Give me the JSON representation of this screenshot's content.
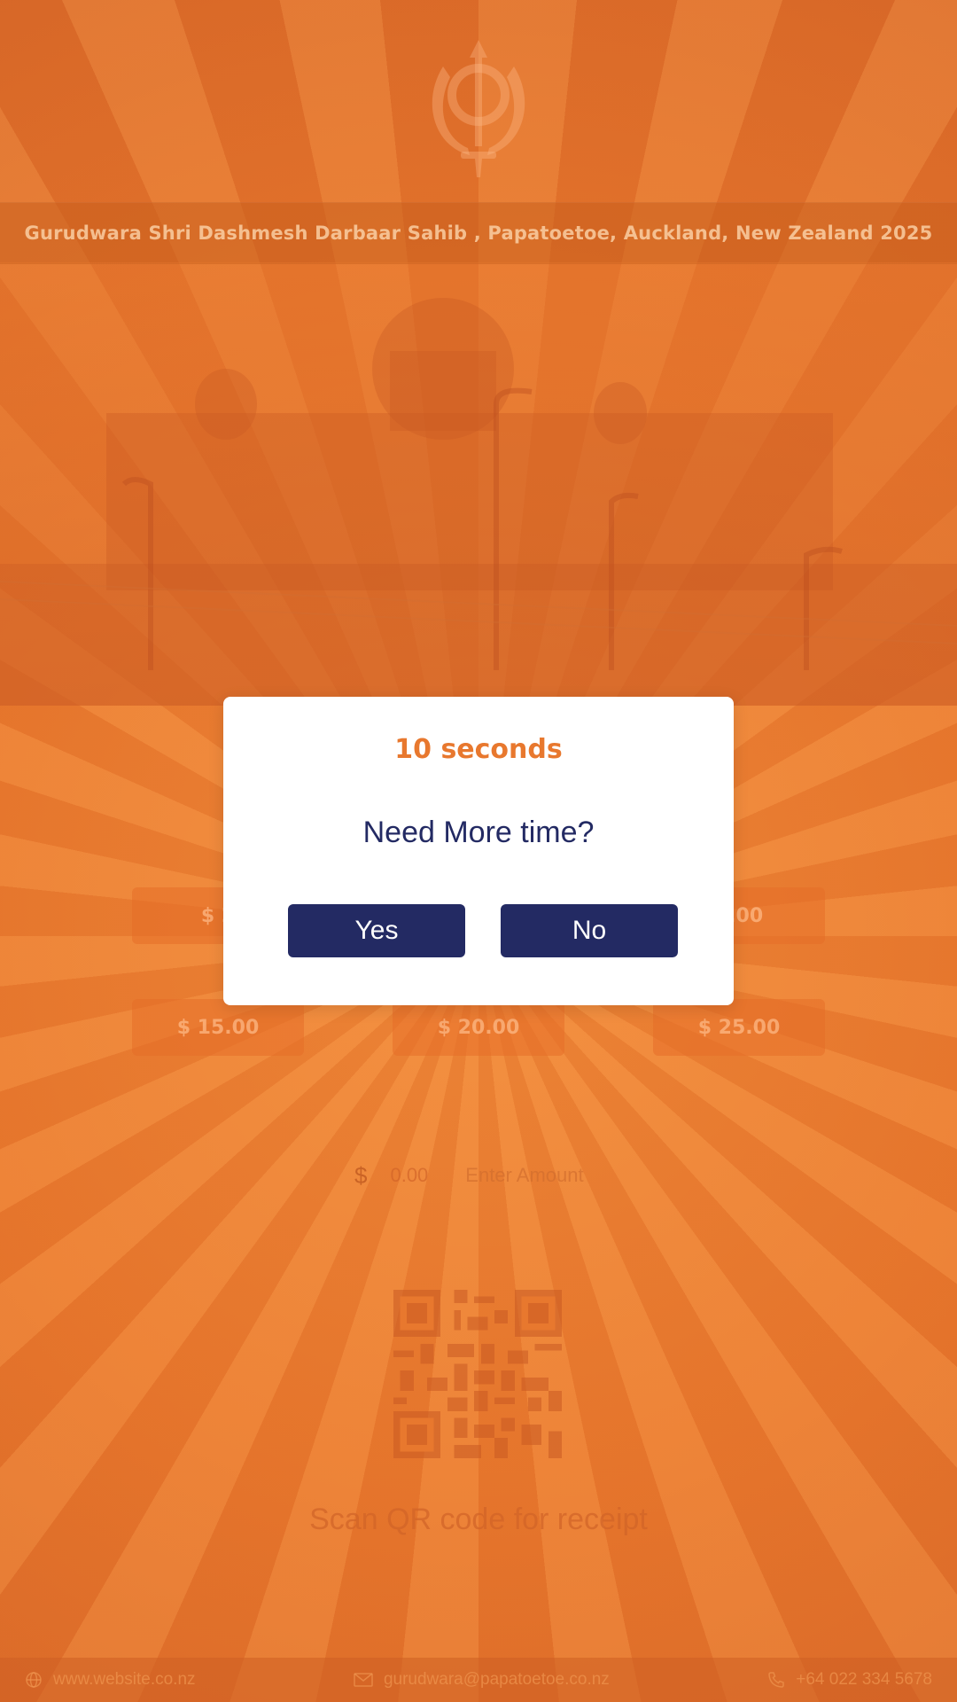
{
  "header": {
    "title": "Gurudwara Shri Dashmesh Darbaar Sahib , Papatoetoe, Auckland, New Zealand 2025",
    "emblem_icon": "khanda-icon"
  },
  "amounts": {
    "row1": [
      "$ 2",
      "",
      "0.00"
    ],
    "row2": [
      "$ 15.00",
      "$ 20.00",
      "$ 25.00"
    ]
  },
  "custom_amount": {
    "currency": "$",
    "value": "0.00",
    "placeholder": "Enter Amount"
  },
  "qr": {
    "caption": "Scan QR code for receipt"
  },
  "footer": {
    "website": "www.website.co.nz",
    "email": "gurudwara@papatoetoe.co.nz",
    "phone": "+64 022 334 5678"
  },
  "modal": {
    "timer": "10 seconds",
    "question": "Need More time?",
    "yes_label": "Yes",
    "no_label": "No"
  },
  "colors": {
    "saffron": "#e8782e",
    "navy": "#232a63",
    "white": "#ffffff"
  }
}
